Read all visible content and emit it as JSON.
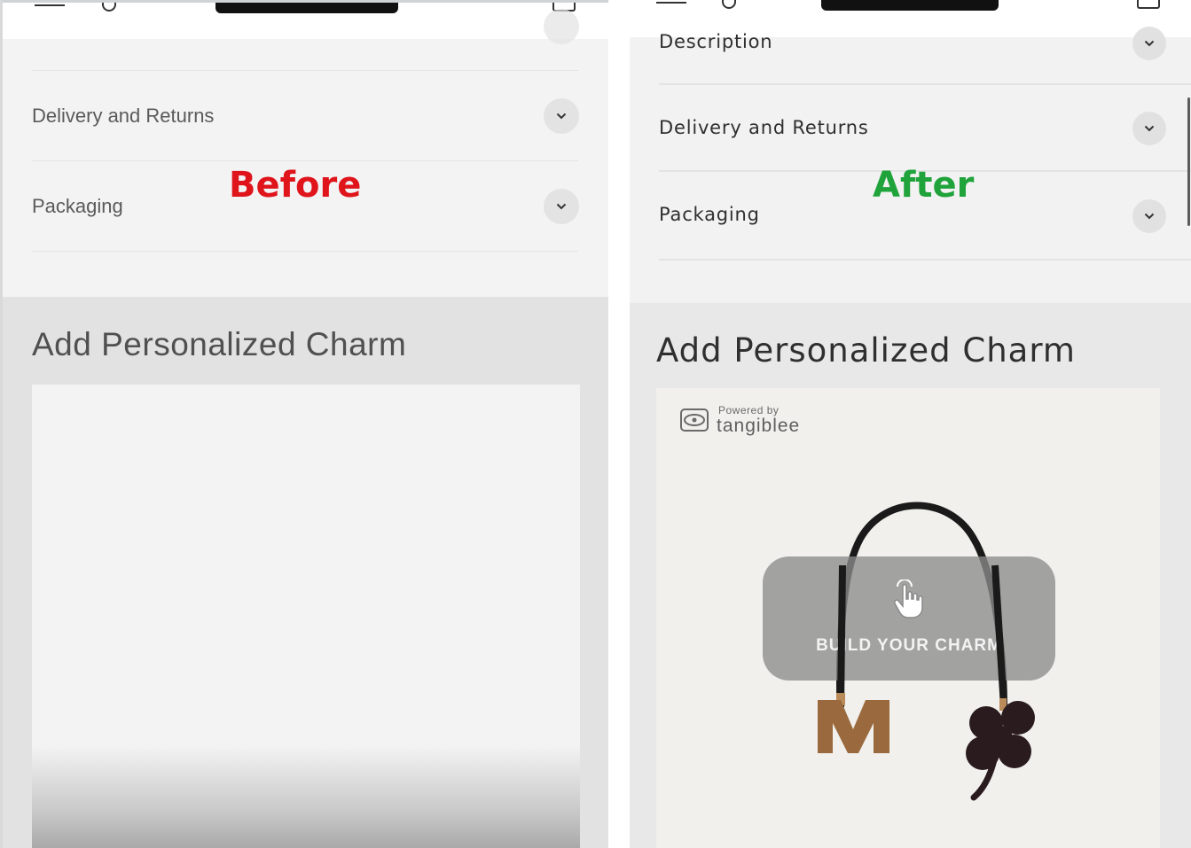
{
  "before": {
    "label": "Before",
    "label_color": "#e0141b",
    "accordion": [
      {
        "label": "Delivery and Returns"
      },
      {
        "label": "Packaging"
      }
    ],
    "charm_title": "Add Personalized Charm"
  },
  "after": {
    "label": "After",
    "label_color": "#1fa33a",
    "accordion": [
      {
        "label": "Description"
      },
      {
        "label": "Delivery and Returns"
      },
      {
        "label": "Packaging"
      }
    ],
    "charm_title": "Add Personalized Charm",
    "widget": {
      "powered_small": "Powered by",
      "powered_brand": "tangiblee",
      "build_button": "BUILD YOUR CHARM",
      "charm_letter": "M"
    }
  },
  "icons": [
    "hamburger-icon",
    "search-icon",
    "bag-icon",
    "chevron-down-icon",
    "hand-pointer-icon",
    "tangiblee-logo-icon",
    "clover-charm-icon"
  ]
}
